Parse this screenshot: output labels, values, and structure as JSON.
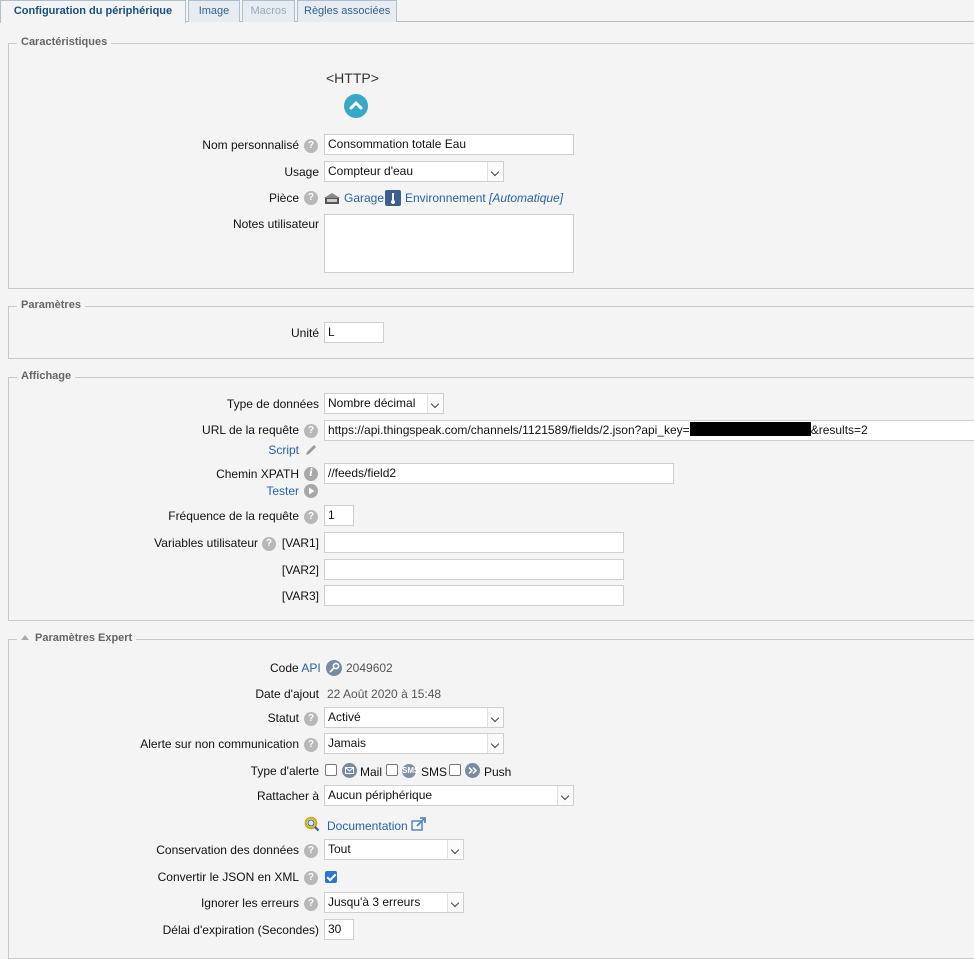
{
  "tabs": [
    {
      "label": "Configuration du périphérique",
      "state": "active"
    },
    {
      "label": "Image",
      "state": "normal"
    },
    {
      "label": "Macros",
      "state": "disabled"
    },
    {
      "label": "Règles associées",
      "state": "normal"
    }
  ],
  "characteristics": {
    "legend": "Caractéristiques",
    "device_type": "<HTTP>",
    "name_label": "Nom personnalisé",
    "name_value": "Consommation totale Eau",
    "usage_label": "Usage",
    "usage_value": "Compteur d'eau",
    "room_label": "Pièce",
    "room_value": "Garage",
    "room_env": "Environnement",
    "room_auto": "[Automatique]",
    "notes_label": "Notes utilisateur"
  },
  "parameters": {
    "legend": "Paramètres",
    "unit_label": "Unité",
    "unit_value": "L"
  },
  "display": {
    "legend": "Affichage",
    "data_type_label": "Type de données",
    "data_type_value": "Nombre décimal",
    "url_label": "URL de la requête",
    "url_value_prefix": "https://api.thingspeak.com/channels/1121589/fields/2.json?api_key=",
    "url_value_suffix": "&results=2",
    "script_link": "Script",
    "xpath_label": "Chemin XPATH",
    "xpath_value": "//feeds/field2",
    "test_link": "Tester",
    "freq_label": "Fréquence de la requête",
    "freq_value": "1",
    "vars_label": "Variables utilisateur",
    "var1_label": "[VAR1]",
    "var2_label": "[VAR2]",
    "var3_label": "[VAR3]"
  },
  "expert": {
    "legend": "Paramètres Expert",
    "api_code_label": "Code",
    "api_link": "API",
    "api_code_value": "2049602",
    "date_label": "Date d'ajout",
    "date_value": "22 Août 2020 à 15:48",
    "status_label": "Statut",
    "status_value": "Activé",
    "alert_label": "Alerte sur non communication",
    "alert_value": "Jamais",
    "alert_type_label": "Type d'alerte",
    "mail_label": "Mail",
    "sms_label": "SMS",
    "sms_icon_text": "SMS",
    "push_label": "Push",
    "attach_label": "Rattacher à",
    "attach_value": "Aucun périphérique",
    "doc_link": "Documentation",
    "retention_label": "Conservation des données",
    "retention_value": "Tout",
    "json_xml_label": "Convertir le JSON en XML",
    "ignore_errors_label": "Ignorer les erreurs",
    "ignore_errors_value": "Jusqu'à 3 erreurs",
    "timeout_label": "Délai d'expiration (Secondes)",
    "timeout_value": "30"
  },
  "icons": {
    "help": "?",
    "info": "i"
  },
  "colors": {
    "accent": "#2a62a6",
    "http_badge": "#3aa7c9",
    "checkbox_checked": "#2f73d6",
    "redaction": "#000000"
  }
}
